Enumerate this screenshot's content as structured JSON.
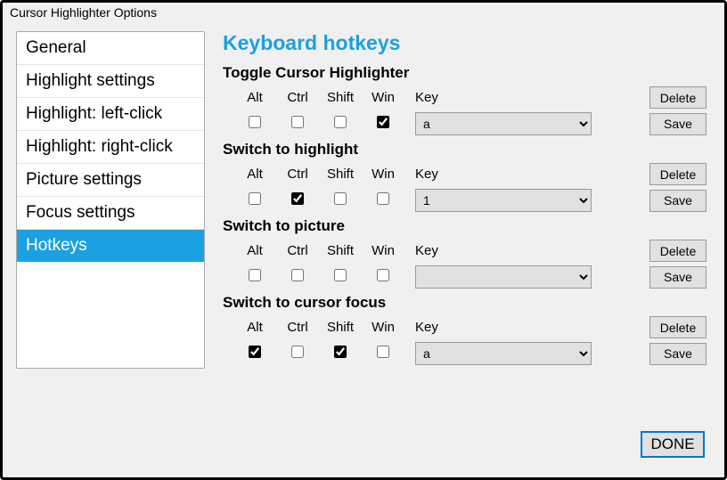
{
  "window": {
    "title": "Cursor Highlighter Options"
  },
  "sidebar": {
    "items": [
      {
        "label": "General",
        "selected": false
      },
      {
        "label": "Highlight settings",
        "selected": false
      },
      {
        "label": "Highlight: left-click",
        "selected": false
      },
      {
        "label": "Highlight: right-click",
        "selected": false
      },
      {
        "label": "Picture settings",
        "selected": false
      },
      {
        "label": "Focus settings",
        "selected": false
      },
      {
        "label": "Hotkeys",
        "selected": true
      }
    ]
  },
  "page": {
    "title": "Keyboard hotkeys"
  },
  "headers": {
    "alt": "Alt",
    "ctrl": "Ctrl",
    "shift": "Shift",
    "win": "Win",
    "key": "Key"
  },
  "buttons": {
    "delete": "Delete",
    "save": "Save",
    "done": "DONE"
  },
  "sections": [
    {
      "title": "Toggle Cursor Highlighter",
      "alt": false,
      "ctrl": false,
      "shift": false,
      "win": true,
      "key": "a"
    },
    {
      "title": "Switch to highlight",
      "alt": false,
      "ctrl": true,
      "shift": false,
      "win": false,
      "key": "1"
    },
    {
      "title": "Switch to picture",
      "alt": false,
      "ctrl": false,
      "shift": false,
      "win": false,
      "key": ""
    },
    {
      "title": "Switch to cursor focus",
      "alt": true,
      "ctrl": false,
      "shift": true,
      "win": false,
      "key": "a"
    }
  ]
}
